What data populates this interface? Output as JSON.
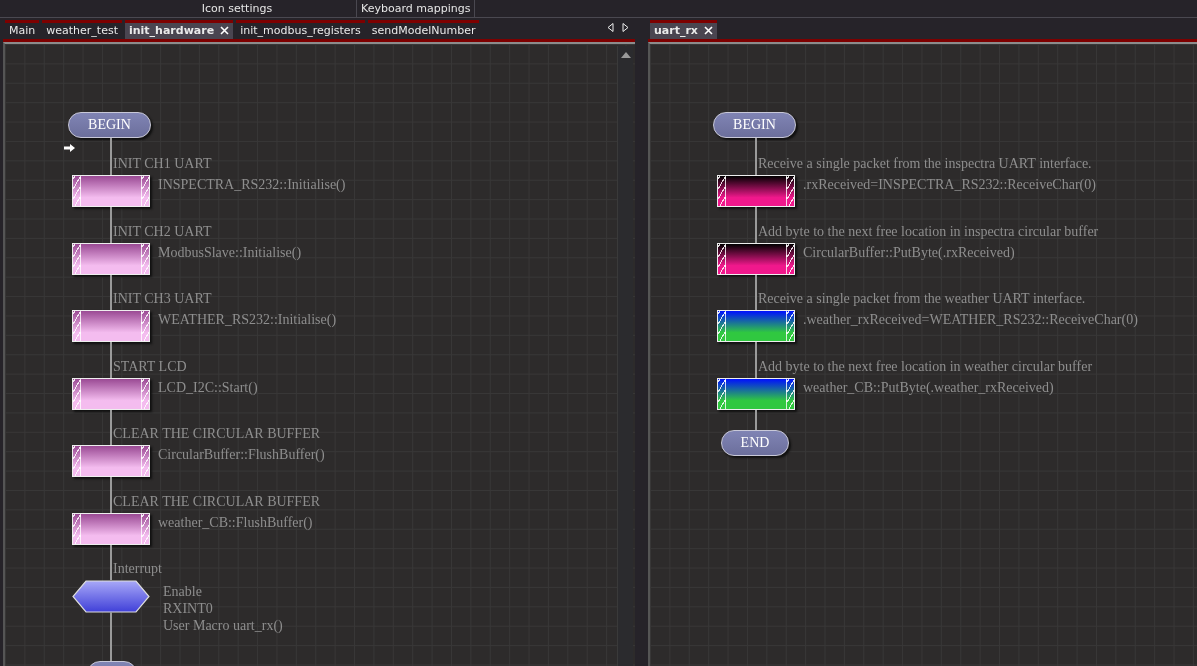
{
  "menu": [
    {
      "label": "Icon settings"
    },
    {
      "label": "Keyboard mappings"
    }
  ],
  "panels": [
    {
      "tabs": [
        {
          "label": "Main",
          "selected": false
        },
        {
          "label": "weather_test",
          "selected": false
        },
        {
          "label": "init_hardware",
          "selected": true
        },
        {
          "label": "init_modbus_registers",
          "selected": false
        },
        {
          "label": "sendModelNumber",
          "selected": false
        }
      ],
      "tab_arrows": true,
      "scrollbar": true,
      "chart": {
        "start": "BEGIN",
        "insert_marker": true,
        "end_cut_off": true,
        "steps": [
          {
            "kind": "call",
            "comment": "INIT CH1 UART",
            "code": "INSPECTRA_RS232::Initialise()",
            "color": "#f4bcef"
          },
          {
            "kind": "call",
            "comment": "INIT CH2 UART",
            "code": "ModbusSlave::Initialise()",
            "color": "#f4bcef"
          },
          {
            "kind": "call",
            "comment": "INIT CH3 UART",
            "code": "WEATHER_RS232::Initialise()",
            "color": "#f4bcef"
          },
          {
            "kind": "call",
            "comment": "START LCD",
            "code": "LCD_I2C::Start()",
            "color": "#f4bcef"
          },
          {
            "kind": "call",
            "comment": "CLEAR THE CIRCULAR BUFFER",
            "code": "CircularBuffer::FlushBuffer()",
            "color": "#f4bcef"
          },
          {
            "kind": "call",
            "comment": "CLEAR THE CIRCULAR BUFFER",
            "code": "weather_CB::FlushBuffer()",
            "color": "#f4bcef"
          },
          {
            "kind": "interrupt",
            "comment": "Interrupt",
            "lines": [
              "Enable",
              "RXINT0",
              "User Macro uart_rx()"
            ]
          }
        ]
      }
    },
    {
      "tabs": [
        {
          "label": "uart_rx",
          "selected": true
        }
      ],
      "chart": {
        "start": "BEGIN",
        "end": "END",
        "steps": [
          {
            "kind": "call",
            "comment": "Receive a single packet from the inspectra UART interface.",
            "code": ".rxReceived=INSPECTRA_RS232::ReceiveChar(0)",
            "color": "#f0188c"
          },
          {
            "kind": "call",
            "comment": "Add byte to the next free location in inspectra circular buffer",
            "code": "CircularBuffer::PutByte(.rxReceived)",
            "color": "#f0188c"
          },
          {
            "kind": "call",
            "comment": "Receive a single packet from the weather UART interface.",
            "code": ".weather_rxReceived=WEATHER_RS232::ReceiveChar(0)",
            "color": "#30c840"
          },
          {
            "kind": "call",
            "comment": "Add byte to the next free location in weather circular buffer",
            "code": "weather_CB::PutByte(.weather_rxReceived)",
            "color": "#30c840"
          }
        ]
      }
    }
  ]
}
